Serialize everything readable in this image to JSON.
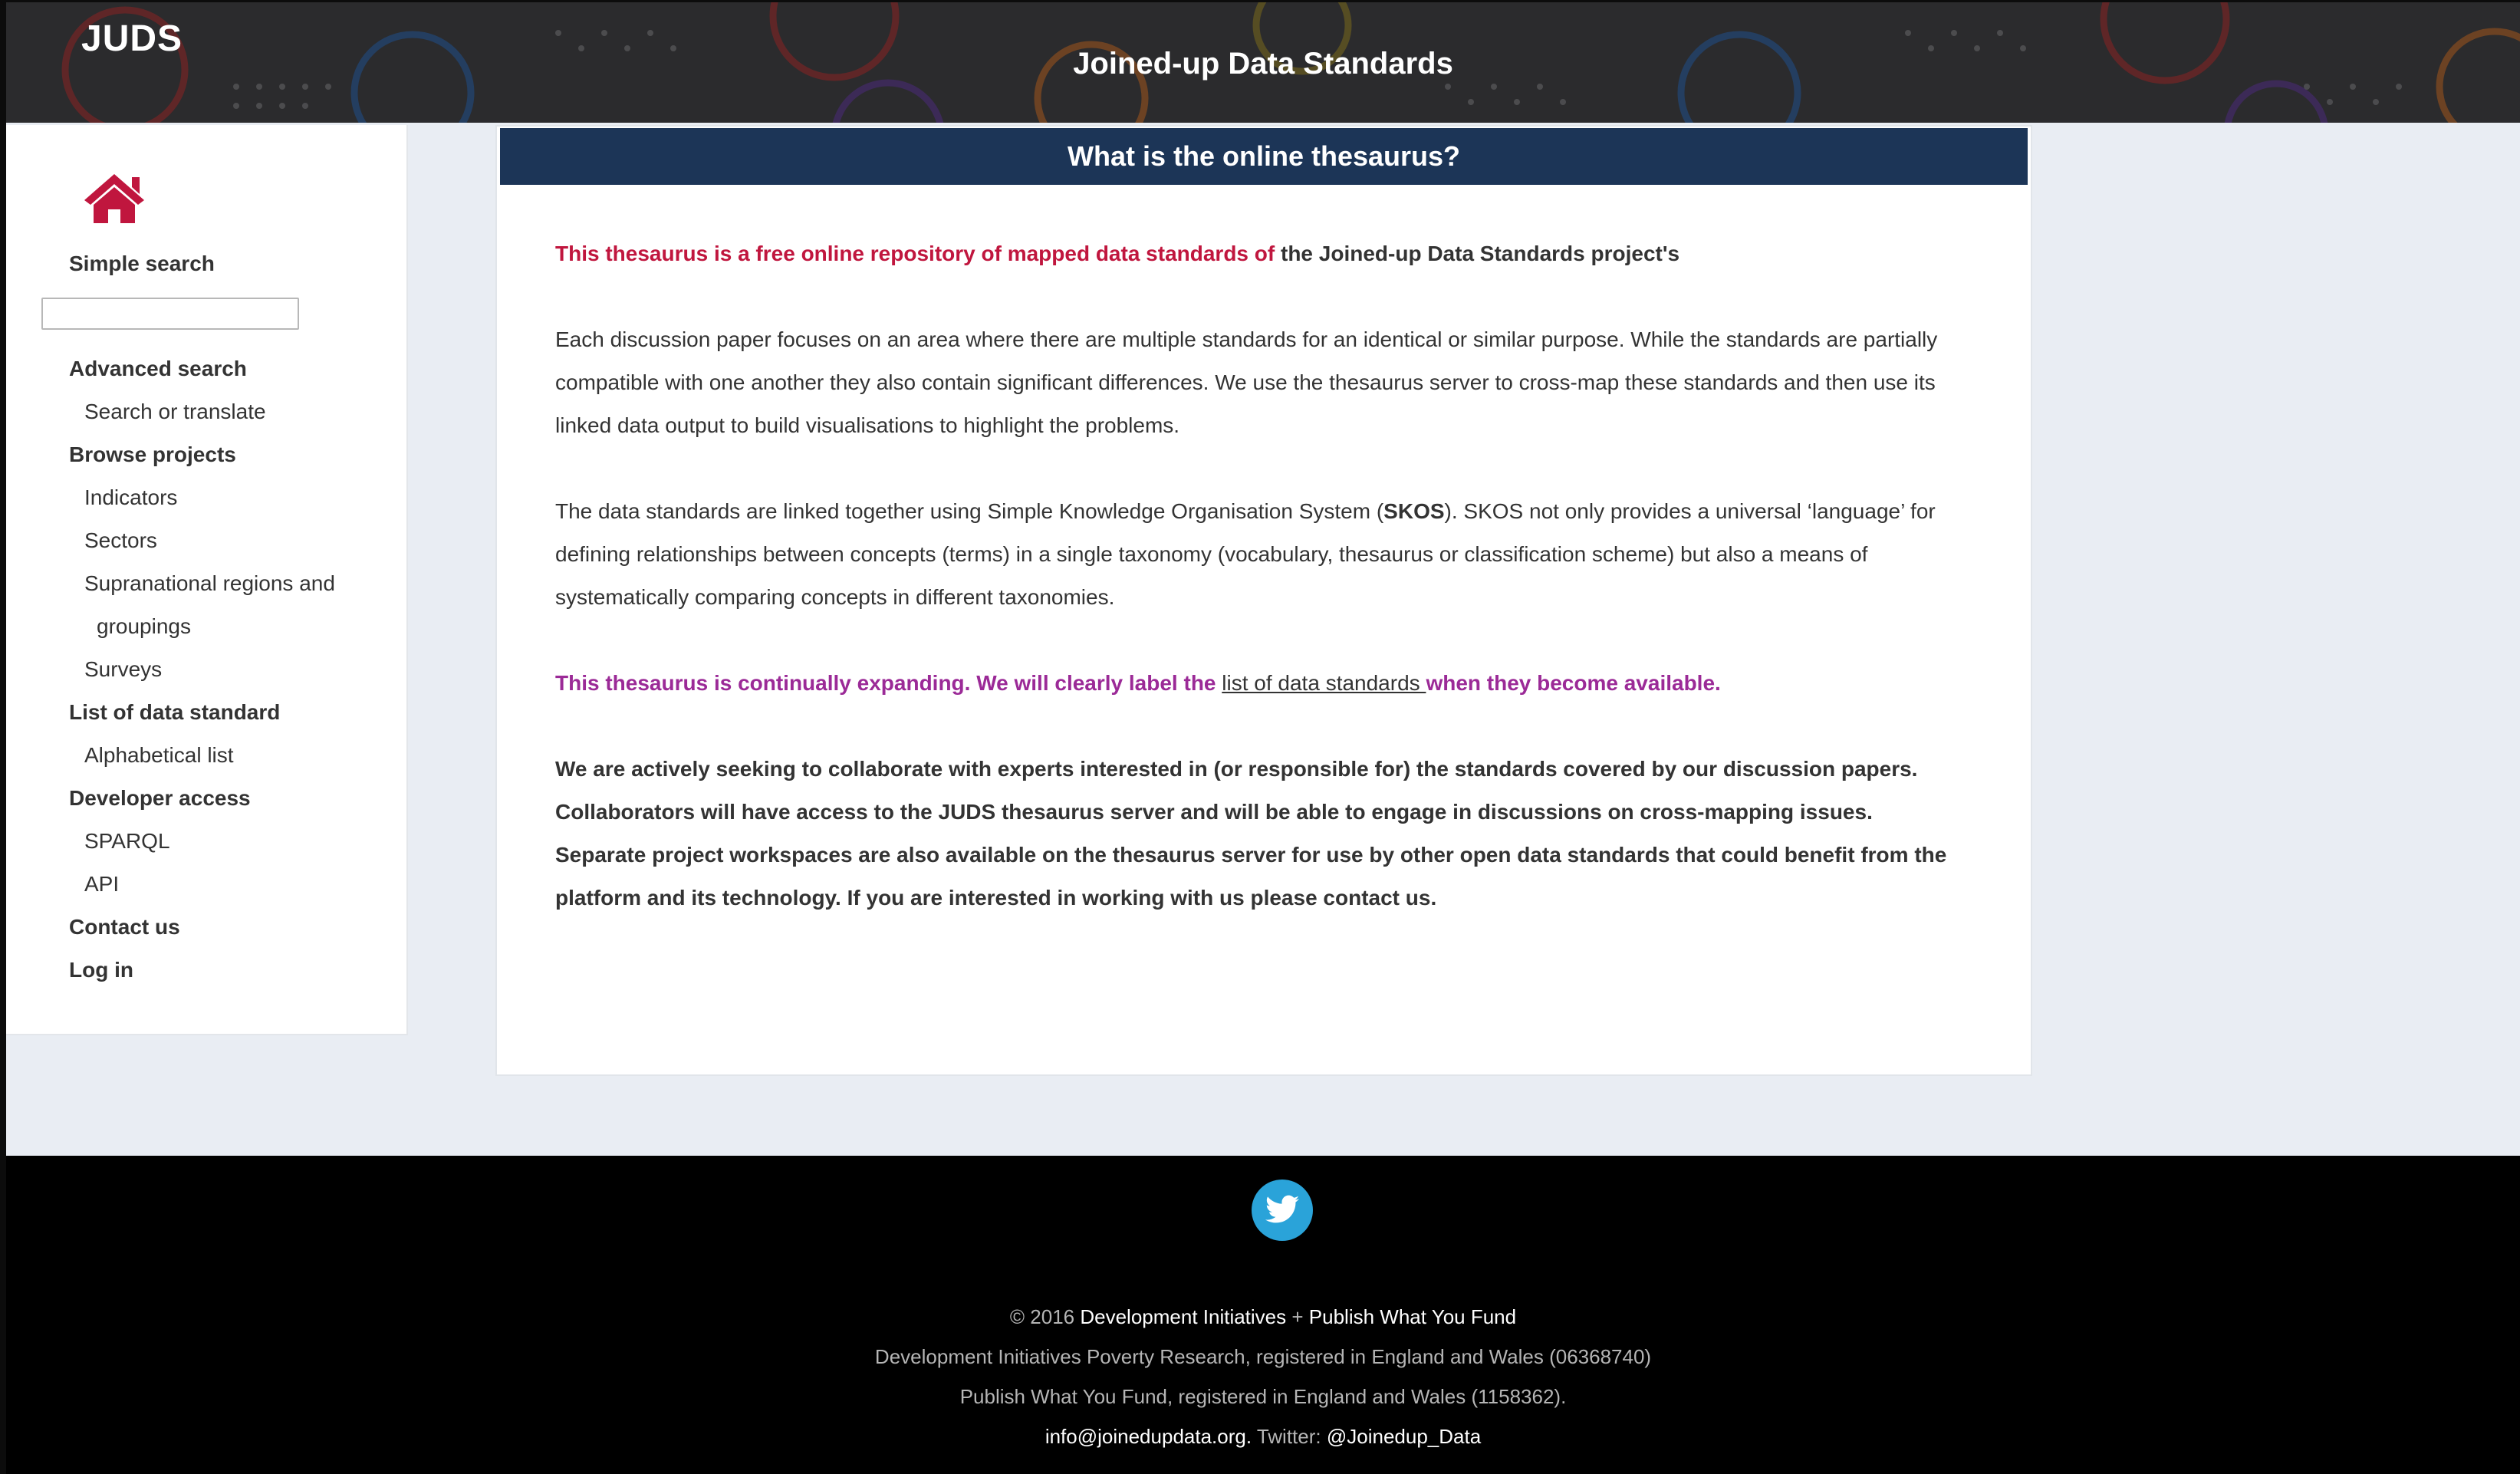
{
  "header": {
    "logo": "JUDS",
    "site_title": "Joined-up Data Standards"
  },
  "sidebar": {
    "home_icon": "home-icon",
    "simple_search": "Simple search",
    "search_value": "",
    "advanced_search": "Advanced search",
    "search_or_translate": "Search or translate",
    "browse_projects": "Browse projects",
    "indicators": "Indicators",
    "sectors": "Sectors",
    "supranational_line1": "Supranational regions and",
    "supranational_line2": "groupings",
    "surveys": "Surveys",
    "list_of_data_standard": "List of data standard",
    "alphabetical_list": "Alphabetical list",
    "developer_access": "Developer access",
    "sparql": "SPARQL",
    "api": "API",
    "contact_us": "Contact us",
    "log_in": "Log in"
  },
  "main": {
    "panel_title": "What is the online thesaurus?",
    "intro_red": "This thesaurus is a free online repository of mapped data standards of",
    "intro_dark": " the Joined-up Data Standards project's",
    "para1": "Each discussion paper focuses on an area where there are multiple standards for an identical or similar purpose. While the standards are partially compatible with one another they also contain significant differences. We use the thesaurus server to cross-map these standards and then use its linked data output to build visualisations to highlight the problems.",
    "para2_before": "The data standards are linked together using Simple Knowledge Organisation System (",
    "para2_bold": "SKOS",
    "para2_after": "). SKOS not only provides a universal ‘language’ for defining relationships between concepts (terms) in a single taxonomy (vocabulary, thesaurus or classification scheme) but also a means of systematically comparing concepts in different taxonomies.",
    "expanding_before": "This thesaurus is continually expanding. We will clearly label the ",
    "expanding_link": "list of data standards ",
    "expanding_after": "when they become available.",
    "collaborate": "We are actively seeking to collaborate with experts interested in (or responsible for) the standards covered by our discussion papers. Collaborators will have access to the JUDS thesaurus server and will be able to engage in discussions on cross-mapping issues. Separate project workspaces are also available on the thesaurus server for use by other open data standards that could benefit from the platform and its technology. If you are interested in working with us please contact us."
  },
  "footer": {
    "twitter_icon": "twitter-icon",
    "copyright": "© 2016 ",
    "di_link": "Development Initiatives",
    "plus": " + ",
    "pwyf_link": "Publish What You Fund",
    "di_reg": "Development Initiatives Poverty Research, registered in England and Wales (06368740)",
    "pwyf_reg": "Publish What You Fund, registered in England and Wales (1158362).",
    "email": "info@joinedupdata.org.",
    "twitter_label": " Twitter: ",
    "twitter_handle": "@Joinedup_Data"
  },
  "colors": {
    "header_bg": "#2b2b2d",
    "panel_header_bg": "#1c3557",
    "accent_red": "#c0163e",
    "accent_purple": "#9b2a97",
    "twitter_blue": "#2aa3d9"
  }
}
